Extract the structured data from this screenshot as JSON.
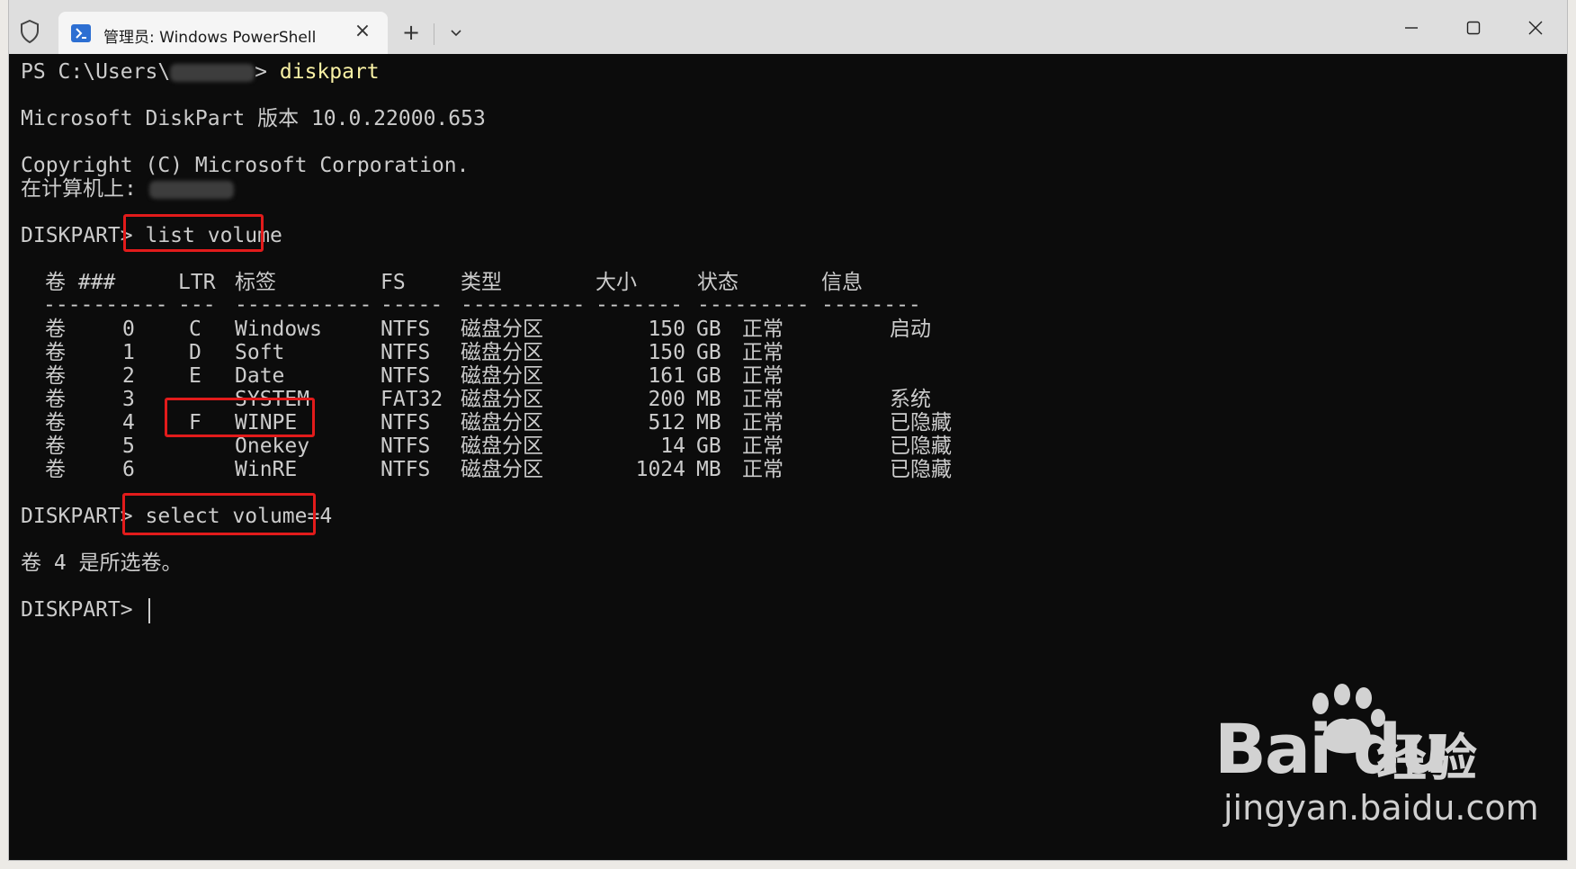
{
  "titlebar": {
    "tab_title": "管理员: Windows PowerShell",
    "tab_close": "×",
    "new_tab": "+",
    "dropdown": "⌄"
  },
  "terminal": {
    "prompt_ps": "PS C:\\Users\\",
    "prompt_ps_tail": "> ",
    "cmd_diskpart": "diskpart",
    "version_line": "Microsoft DiskPart 版本 10.0.22000.653",
    "copyright_line": "Copyright (C) Microsoft Corporation.",
    "computer_line": "在计算机上: ",
    "diskpart_prompt": "DISKPART> ",
    "cmd_list_volume": "list volume",
    "headers": {
      "vol": "卷 ###",
      "ltr": "LTR",
      "label": "标签",
      "fs": "FS",
      "type": "类型",
      "size": "大小",
      "status": "状态",
      "info": "信息"
    },
    "dashes": {
      "vol": "----------",
      "ltr": "---",
      "label": "-----------",
      "fs": "-----",
      "type": "----------",
      "size": "-------",
      "status": "---------",
      "info": "--------"
    },
    "volumes": [
      {
        "vol": "卷",
        "num": "0",
        "ltr": "C",
        "label": "Windows",
        "fs": "NTFS",
        "type": "磁盘分区",
        "size": "150",
        "unit": "GB",
        "status": "正常",
        "info": "启动"
      },
      {
        "vol": "卷",
        "num": "1",
        "ltr": "D",
        "label": "Soft",
        "fs": "NTFS",
        "type": "磁盘分区",
        "size": "150",
        "unit": "GB",
        "status": "正常",
        "info": ""
      },
      {
        "vol": "卷",
        "num": "2",
        "ltr": "E",
        "label": "Date",
        "fs": "NTFS",
        "type": "磁盘分区",
        "size": "161",
        "unit": "GB",
        "status": "正常",
        "info": ""
      },
      {
        "vol": "卷",
        "num": "3",
        "ltr": "",
        "label": "SYSTEM",
        "fs": "FAT32",
        "type": "磁盘分区",
        "size": "200",
        "unit": "MB",
        "status": "正常",
        "info": "系统"
      },
      {
        "vol": "卷",
        "num": "4",
        "ltr": "F",
        "label": "WINPE",
        "fs": "NTFS",
        "type": "磁盘分区",
        "size": "512",
        "unit": "MB",
        "status": "正常",
        "info": "已隐藏"
      },
      {
        "vol": "卷",
        "num": "5",
        "ltr": "",
        "label": "Onekey",
        "fs": "NTFS",
        "type": "磁盘分区",
        "size": "14",
        "unit": "GB",
        "status": "正常",
        "info": "已隐藏"
      },
      {
        "vol": "卷",
        "num": "6",
        "ltr": "",
        "label": "WinRE",
        "fs": "NTFS",
        "type": "磁盘分区",
        "size": "1024",
        "unit": "MB",
        "status": "正常",
        "info": "已隐藏"
      }
    ],
    "cmd_select_volume": "select volume=4",
    "selected_message": "卷 4 是所选卷。"
  },
  "watermark": {
    "baidu": "Bai  du",
    "jingyan": "经验",
    "url": "jingyan.baidu.com"
  },
  "colors": {
    "background": "#0c0c0c",
    "text": "#cccccc",
    "command": "#f9f1a5",
    "highlight_box": "#e21b1b",
    "titlebar": "#dedede"
  }
}
